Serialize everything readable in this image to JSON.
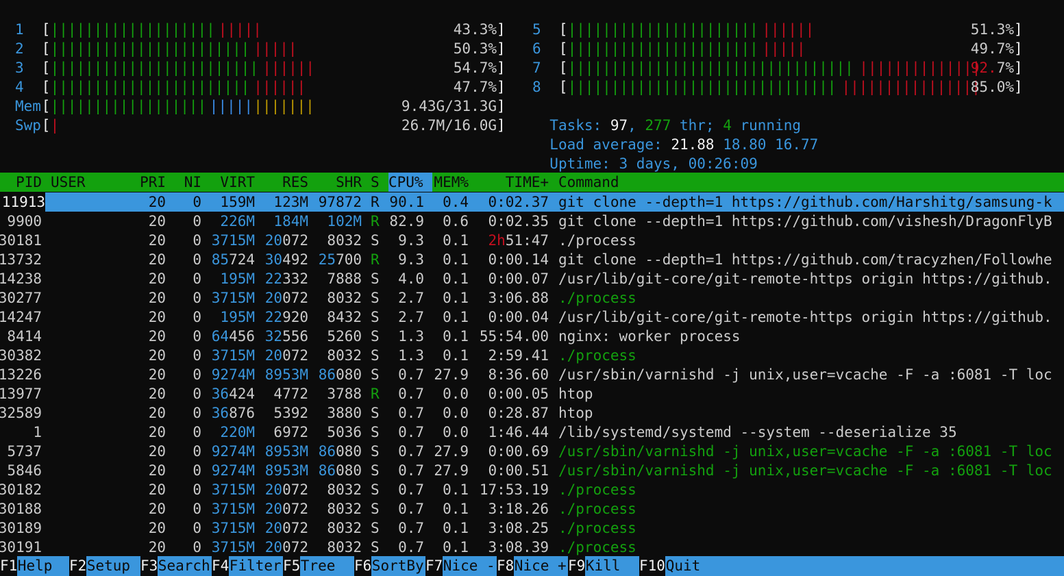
{
  "cpus": [
    {
      "id": "1",
      "green": 19,
      "red": 5,
      "label": "43.3%"
    },
    {
      "id": "2",
      "green": 23,
      "red": 5,
      "label": "50.3%"
    },
    {
      "id": "3",
      "green": 24,
      "red": 6,
      "label": "54.7%"
    },
    {
      "id": "4",
      "green": 23,
      "red": 6,
      "label": "47.7%"
    },
    {
      "id": "5",
      "green": 22,
      "red": 6,
      "label": "51.3%"
    },
    {
      "id": "6",
      "green": 22,
      "red": 5,
      "label": "49.7%"
    },
    {
      "id": "7",
      "green": 33,
      "red": 14,
      "label_pre": "92.",
      "label_post": "7%"
    },
    {
      "id": "8",
      "green": 31,
      "red": 16,
      "label": "85.0%"
    }
  ],
  "mem": {
    "label": "Mem",
    "green": 18,
    "blue": 5,
    "yellow": 7,
    "value": "9.43G/31.3G"
  },
  "swp": {
    "label": "Swp",
    "red": 1,
    "value": "26.7M/16.0G"
  },
  "tasks": {
    "label": "Tasks: ",
    "count": "97",
    "sep": ", ",
    "thr": "277",
    "thr_label": " thr; ",
    "running": "4",
    "running_label": " running"
  },
  "load": {
    "label": "Load average: ",
    "v1": "21.88",
    "v2": "18.80",
    "v3": "16.77"
  },
  "uptime": {
    "label": "Uptime: ",
    "value": "3 days, 00:26:09"
  },
  "columns": {
    "pid": "PID",
    "user": "USER",
    "pri": "PRI",
    "ni": "NI",
    "virt": "VIRT",
    "res": "RES",
    "shr": "SHR",
    "s": "S",
    "cpu": "CPU%",
    "mem": "MEM%",
    "time": "TIME+",
    "command": "Command"
  },
  "processes": [
    {
      "pid": "11913",
      "user": "",
      "pri": "20",
      "ni": "0",
      "virt": "159M",
      "res": "123M",
      "shr": "97872",
      "s": "R",
      "cpu": "90.1",
      "mem": "0.4",
      "time": "0:02.37",
      "command": "git clone --depth=1 https://github.com/Harshitg/samsung-k"
    },
    {
      "pid": "9900",
      "user": "",
      "pri": "20",
      "ni": "0",
      "virt": "226M",
      "res": "184M",
      "shr": "102M",
      "s": "R",
      "cpu": "82.9",
      "mem": "0.6",
      "time": "0:02.35",
      "command": "git clone --depth=1 https://github.com/vishesh/DragonFlyB"
    },
    {
      "pid": "30181",
      "user": "",
      "pri": "20",
      "ni": "0",
      "virt": "3715M",
      "res": "20072",
      "shr": "8032",
      "s": "S",
      "cpu": "9.3",
      "mem": "0.1",
      "time": "2h51:47",
      "command": "./process"
    },
    {
      "pid": "13732",
      "user": "",
      "pri": "20",
      "ni": "0",
      "virt": "85724",
      "res": "30492",
      "shr": "25700",
      "s": "R",
      "cpu": "9.3",
      "mem": "0.1",
      "time": "0:00.14",
      "command": "git clone --depth=1 https://github.com/tracyzhen/Followhe"
    },
    {
      "pid": "14238",
      "user": "",
      "pri": "20",
      "ni": "0",
      "virt": "195M",
      "res": "22332",
      "shr": "7888",
      "s": "S",
      "cpu": "4.0",
      "mem": "0.1",
      "time": "0:00.07",
      "command": "/usr/lib/git-core/git-remote-https origin https://github."
    },
    {
      "pid": "30277",
      "user": "",
      "pri": "20",
      "ni": "0",
      "virt": "3715M",
      "res": "20072",
      "shr": "8032",
      "s": "S",
      "cpu": "2.7",
      "mem": "0.1",
      "time": "3:06.88",
      "command": "./process",
      "thread": true
    },
    {
      "pid": "14247",
      "user": "",
      "pri": "20",
      "ni": "0",
      "virt": "195M",
      "res": "22920",
      "shr": "8432",
      "s": "S",
      "cpu": "2.7",
      "mem": "0.1",
      "time": "0:00.04",
      "command": "/usr/lib/git-core/git-remote-https origin https://github."
    },
    {
      "pid": "8414",
      "user": "",
      "pri": "20",
      "ni": "0",
      "virt": "64456",
      "res": "32556",
      "shr": "5260",
      "s": "S",
      "cpu": "1.3",
      "mem": "0.1",
      "time": "55:54.00",
      "command": "nginx: worker process"
    },
    {
      "pid": "30382",
      "user": "",
      "pri": "20",
      "ni": "0",
      "virt": "3715M",
      "res": "20072",
      "shr": "8032",
      "s": "S",
      "cpu": "1.3",
      "mem": "0.1",
      "time": "2:59.41",
      "command": "./process",
      "thread": true
    },
    {
      "pid": "13226",
      "user": "",
      "pri": "20",
      "ni": "0",
      "virt": "9274M",
      "res": "8953M",
      "shr": "86080",
      "s": "S",
      "cpu": "0.7",
      "mem": "27.9",
      "time": "8:36.60",
      "command": "/usr/sbin/varnishd -j unix,user=vcache -F -a :6081 -T loc"
    },
    {
      "pid": "13977",
      "user": "",
      "pri": "20",
      "ni": "0",
      "virt": "36424",
      "res": "4772",
      "shr": "3788",
      "s": "R",
      "cpu": "0.7",
      "mem": "0.0",
      "time": "0:00.05",
      "command": "htop"
    },
    {
      "pid": "32589",
      "user": "",
      "pri": "20",
      "ni": "0",
      "virt": "36876",
      "res": "5392",
      "shr": "3880",
      "s": "S",
      "cpu": "0.7",
      "mem": "0.0",
      "time": "0:28.87",
      "command": "htop"
    },
    {
      "pid": "1",
      "user": "",
      "pri": "20",
      "ni": "0",
      "virt": "220M",
      "res": "6972",
      "shr": "5036",
      "s": "S",
      "cpu": "0.7",
      "mem": "0.0",
      "time": "1:46.44",
      "command": "/lib/systemd/systemd --system --deserialize 35"
    },
    {
      "pid": "5737",
      "user": "",
      "pri": "20",
      "ni": "0",
      "virt": "9274M",
      "res": "8953M",
      "shr": "86080",
      "s": "S",
      "cpu": "0.7",
      "mem": "27.9",
      "time": "0:00.69",
      "command": "/usr/sbin/varnishd -j unix,user=vcache -F -a :6081 -T loc",
      "thread": true
    },
    {
      "pid": "5846",
      "user": "",
      "pri": "20",
      "ni": "0",
      "virt": "9274M",
      "res": "8953M",
      "shr": "86080",
      "s": "S",
      "cpu": "0.7",
      "mem": "27.9",
      "time": "0:00.51",
      "command": "/usr/sbin/varnishd -j unix,user=vcache -F -a :6081 -T loc",
      "thread": true
    },
    {
      "pid": "30182",
      "user": "",
      "pri": "20",
      "ni": "0",
      "virt": "3715M",
      "res": "20072",
      "shr": "8032",
      "s": "S",
      "cpu": "0.7",
      "mem": "0.1",
      "time": "17:53.19",
      "command": "./process",
      "thread": true
    },
    {
      "pid": "30188",
      "user": "",
      "pri": "20",
      "ni": "0",
      "virt": "3715M",
      "res": "20072",
      "shr": "8032",
      "s": "S",
      "cpu": "0.7",
      "mem": "0.1",
      "time": "3:18.26",
      "command": "./process",
      "thread": true
    },
    {
      "pid": "30189",
      "user": "",
      "pri": "20",
      "ni": "0",
      "virt": "3715M",
      "res": "20072",
      "shr": "8032",
      "s": "S",
      "cpu": "0.7",
      "mem": "0.1",
      "time": "3:08.25",
      "command": "./process",
      "thread": true
    },
    {
      "pid": "30191",
      "user": "",
      "pri": "20",
      "ni": "0",
      "virt": "3715M",
      "res": "20072",
      "shr": "8032",
      "s": "S",
      "cpu": "0.7",
      "mem": "0.1",
      "time": "3:08.39",
      "command": "./process",
      "thread": true
    }
  ],
  "footer": [
    {
      "key": "F1",
      "label": "Help"
    },
    {
      "key": "F2",
      "label": "Setup"
    },
    {
      "key": "F3",
      "label": "Search"
    },
    {
      "key": "F4",
      "label": "Filter"
    },
    {
      "key": "F5",
      "label": "Tree"
    },
    {
      "key": "F6",
      "label": "SortBy"
    },
    {
      "key": "F7",
      "label": "Nice -"
    },
    {
      "key": "F8",
      "label": "Nice +"
    },
    {
      "key": "F9",
      "label": "Kill"
    },
    {
      "key": "F10",
      "label": "Quit"
    }
  ],
  "colors": {
    "bg": "#0c0c0c",
    "green": "#13a10e",
    "blue": "#3a96dd",
    "red": "#c50f1f",
    "yellow": "#c19c00"
  }
}
